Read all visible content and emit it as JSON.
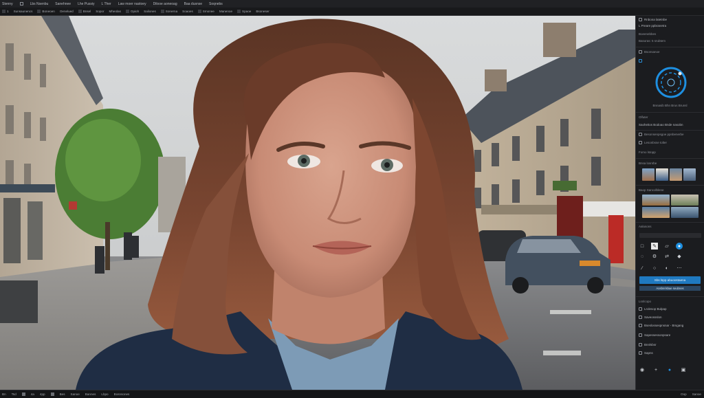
{
  "menubar": {
    "items": [
      "Stenny",
      "Lbs Nsenbu",
      "Sanehnee",
      "Lhe Pussiy",
      "L Ther",
      "Law moer nastoey",
      "Dilooe aoneoag",
      "Baa dusnse",
      "Soqnebs"
    ]
  },
  "options": {
    "items": [
      "1",
      "Sunsaunencs",
      "Boneoen",
      "Oenelued",
      "Bnsel",
      "Sopor",
      "Mheolas",
      "Opioh",
      "Saliones",
      "Sonerna",
      "Soaoes",
      "Smonee",
      "Manenoe",
      "Spaoe",
      "Bsoneser"
    ]
  },
  "panel": {
    "header_title": "Rnbona latetnbe",
    "header_sub": "L Preare ppbranetra",
    "line3": "Boeenebbes",
    "line4": "Basoras: 5 srubtem",
    "line5": "Bsonsanoe",
    "dial_caption": "Bnnasib Bhn Brus Brunsl",
    "section1": "Olfuter",
    "section1_sub": "Saoheitos Bodoao Bnde nasobn",
    "item_a": "Besonsenpsgoe ppnbenerbe",
    "item_b": "Lesonbsse tolter",
    "item_c": "Fomo lstopp",
    "presets_label": "Bnsa losnrbe",
    "presets_label2": "Baop Sancolblene",
    "adjust_label": "Aalusons",
    "apply_button": "Sbs lspp abuoostaena",
    "secondary_button": "Aosbnrisbae seubnes",
    "list_label": "Lsnlcopo",
    "layers": [
      "Lrolesop Bulpap",
      "Saveossslon",
      "Bseslossespnsnar - Brsgang",
      "Sapessessonpsare",
      "Bnnlsbsr",
      "Sapns"
    ]
  },
  "status": {
    "left": [
      "Bn",
      "Tsd",
      "4a",
      "4pp",
      "Bes",
      "Sanoe",
      "Bannes",
      "Lbpo",
      "Bosnsones"
    ],
    "right": [
      "Oop",
      "Sanoe"
    ]
  },
  "colors": {
    "accent": "#1f79c0",
    "dial_blue": "#1e8fe0",
    "menubar_bg": "#202124",
    "panel_bg": "#1b1c1f"
  },
  "icons": {
    "dial": "target-dial-icon",
    "eye": "eye-icon",
    "brush": "brush-icon",
    "gear": "gear-icon",
    "folder": "folder-icon",
    "trash": "trash-icon"
  }
}
